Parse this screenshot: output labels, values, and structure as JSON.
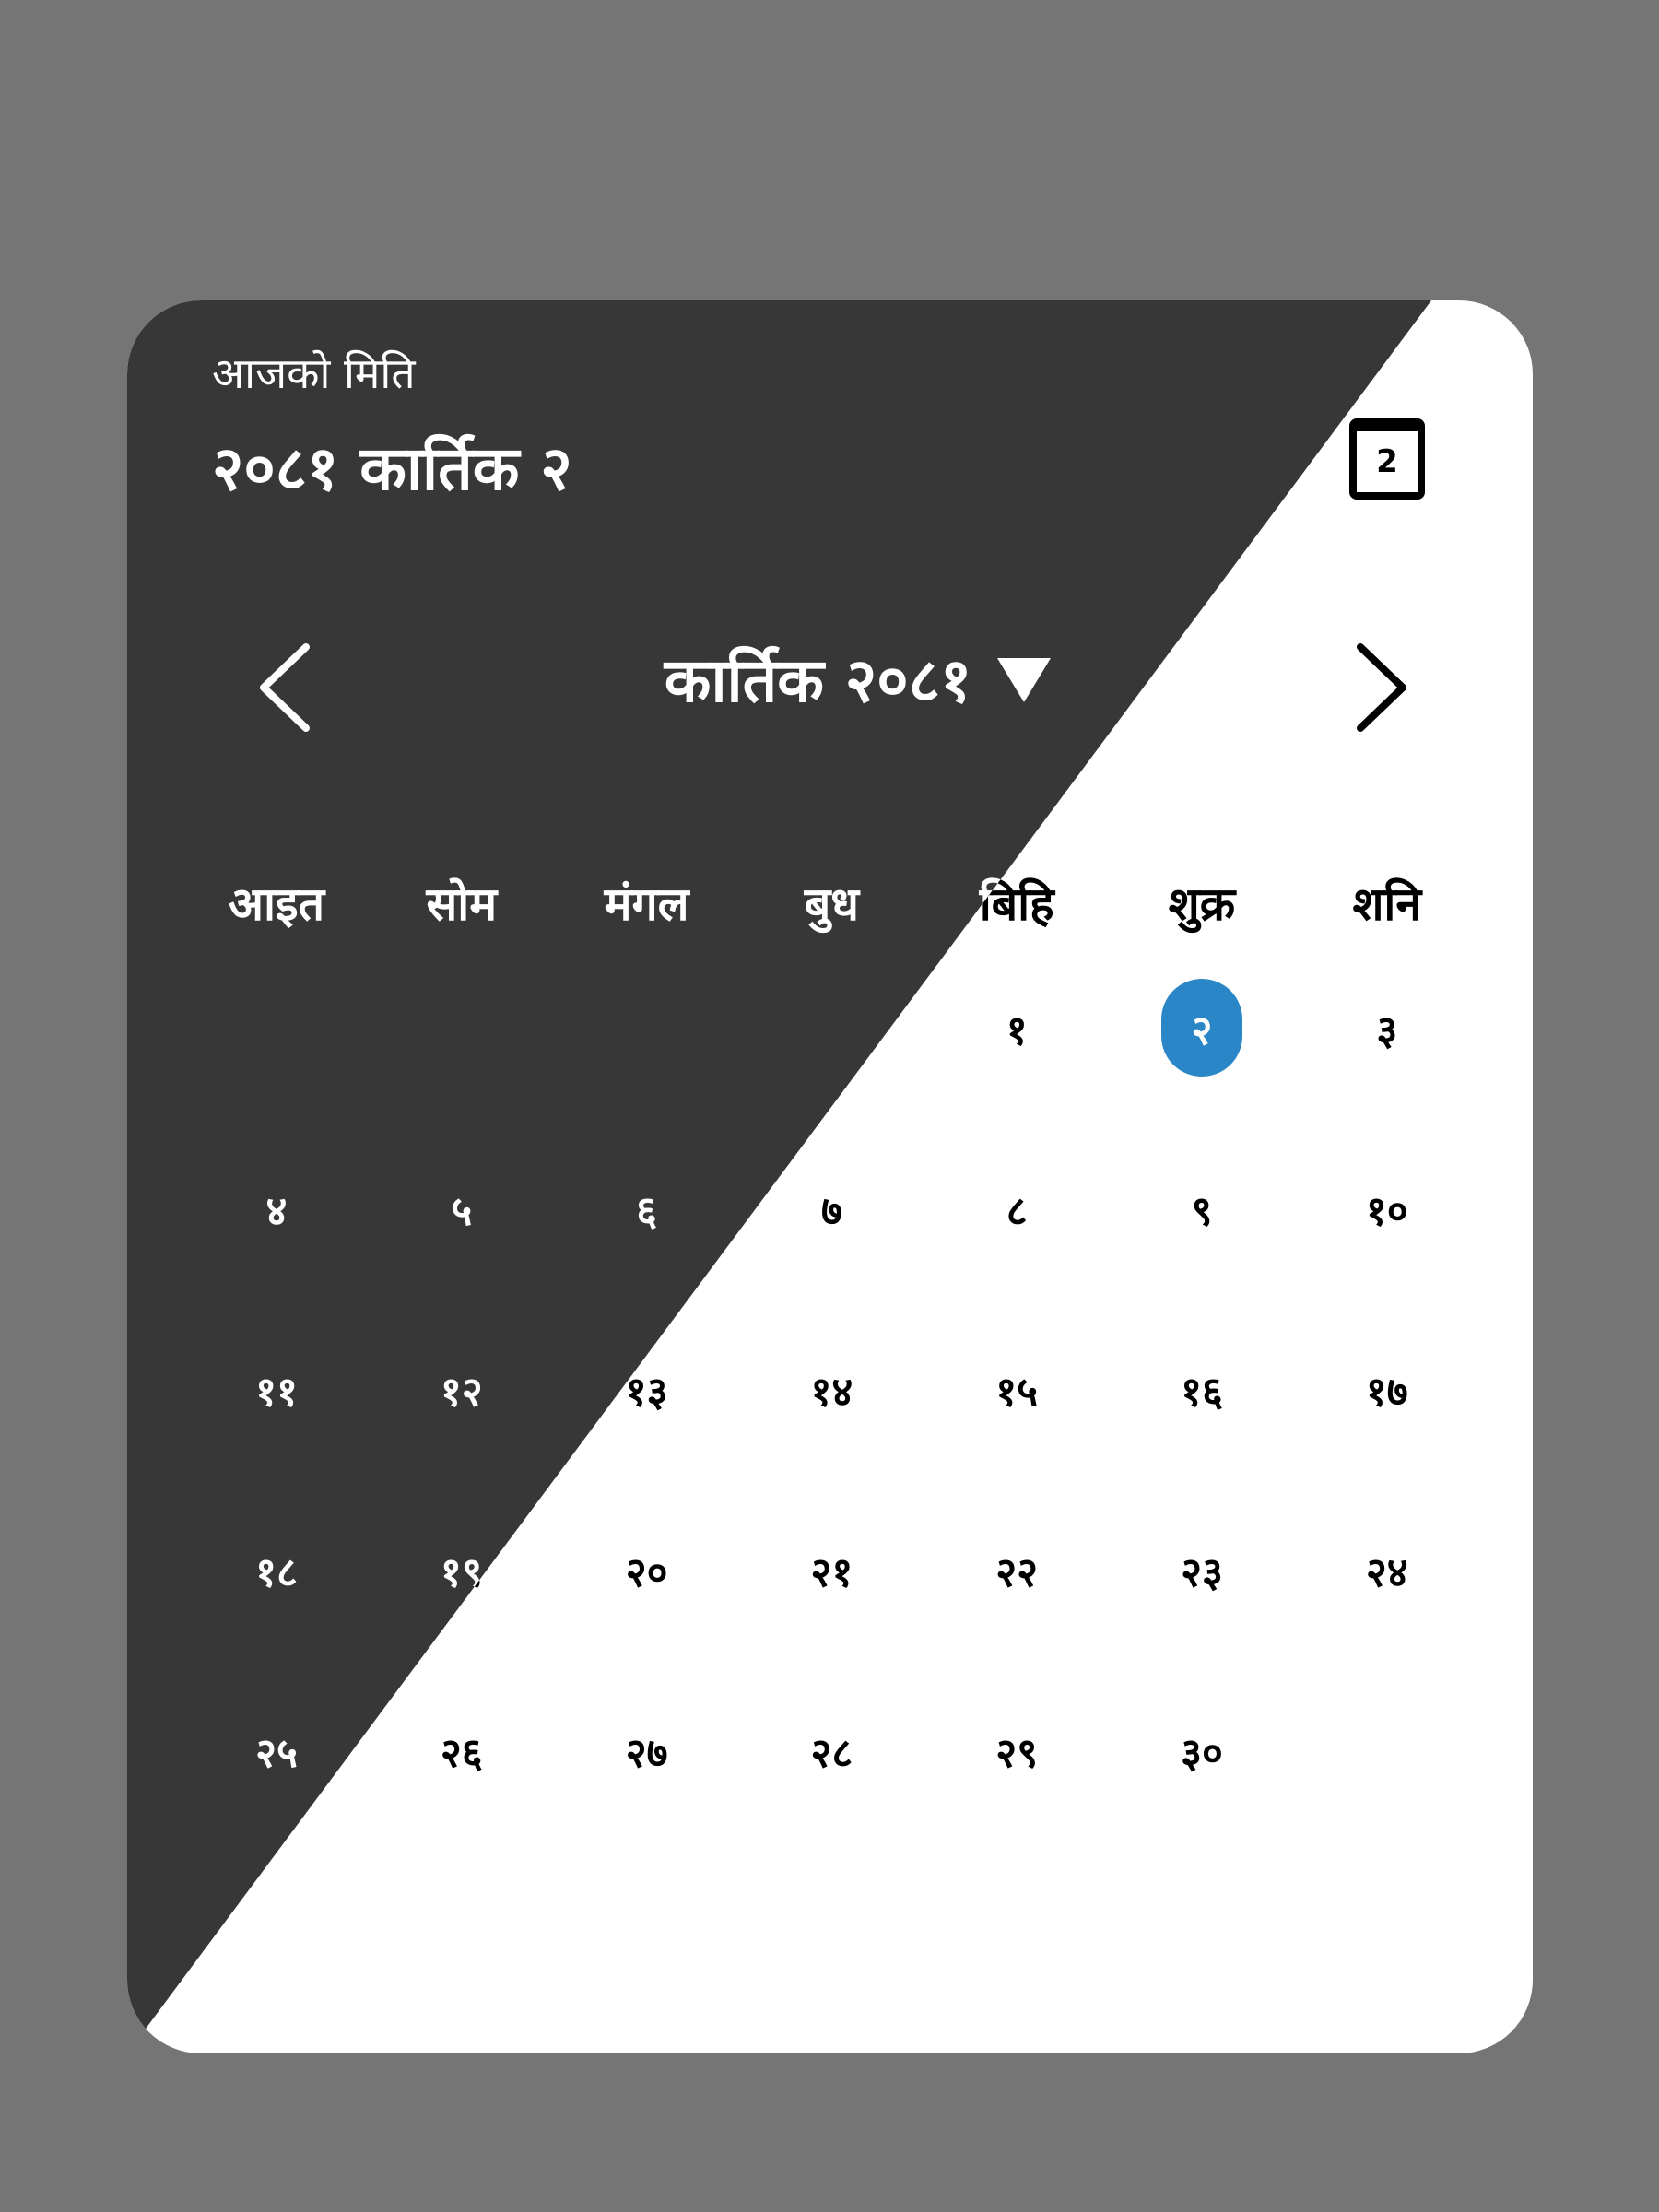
{
  "today": {
    "label": "आजको मिति",
    "date": "२०८१ कार्तिक   २",
    "button_label": "2"
  },
  "navigation": {
    "prev_icon": "chevron-left-icon",
    "next_icon": "chevron-right-icon",
    "month_title": "कार्तिक २०८१",
    "dropdown_icon": "caret-down-icon"
  },
  "weekdays": [
    "आइत",
    "सोम",
    "मंगल",
    "बुध",
    "बिहि",
    "शुक्र",
    "शनि"
  ],
  "days": [
    {
      "label": "१",
      "col": 4,
      "row": 0
    },
    {
      "label": "२",
      "col": 5,
      "row": 0,
      "selected": true
    },
    {
      "label": "३",
      "col": 6,
      "row": 0
    },
    {
      "label": "४",
      "col": 0,
      "row": 1
    },
    {
      "label": "५",
      "col": 1,
      "row": 1
    },
    {
      "label": "६",
      "col": 2,
      "row": 1
    },
    {
      "label": "७",
      "col": 3,
      "row": 1
    },
    {
      "label": "८",
      "col": 4,
      "row": 1
    },
    {
      "label": "९",
      "col": 5,
      "row": 1
    },
    {
      "label": "१०",
      "col": 6,
      "row": 1
    },
    {
      "label": "११",
      "col": 0,
      "row": 2
    },
    {
      "label": "१२",
      "col": 1,
      "row": 2
    },
    {
      "label": "१३",
      "col": 2,
      "row": 2
    },
    {
      "label": "१४",
      "col": 3,
      "row": 2
    },
    {
      "label": "१५",
      "col": 4,
      "row": 2
    },
    {
      "label": "१६",
      "col": 5,
      "row": 2
    },
    {
      "label": "१७",
      "col": 6,
      "row": 2
    },
    {
      "label": "१८",
      "col": 0,
      "row": 3
    },
    {
      "label": "१९",
      "col": 1,
      "row": 3
    },
    {
      "label": "२०",
      "col": 2,
      "row": 3
    },
    {
      "label": "२१",
      "col": 3,
      "row": 3
    },
    {
      "label": "२२",
      "col": 4,
      "row": 3
    },
    {
      "label": "२३",
      "col": 5,
      "row": 3
    },
    {
      "label": "२४",
      "col": 6,
      "row": 3
    },
    {
      "label": "२५",
      "col": 0,
      "row": 4
    },
    {
      "label": "२६",
      "col": 1,
      "row": 4
    },
    {
      "label": "२७",
      "col": 2,
      "row": 4
    },
    {
      "label": "२८",
      "col": 3,
      "row": 4
    },
    {
      "label": "२९",
      "col": 4,
      "row": 4
    },
    {
      "label": "३०",
      "col": 5,
      "row": 4
    }
  ],
  "colors": {
    "background": "#757575",
    "card_dark": "#373737",
    "card_light": "#ffffff",
    "selected": "#2a86c7"
  }
}
